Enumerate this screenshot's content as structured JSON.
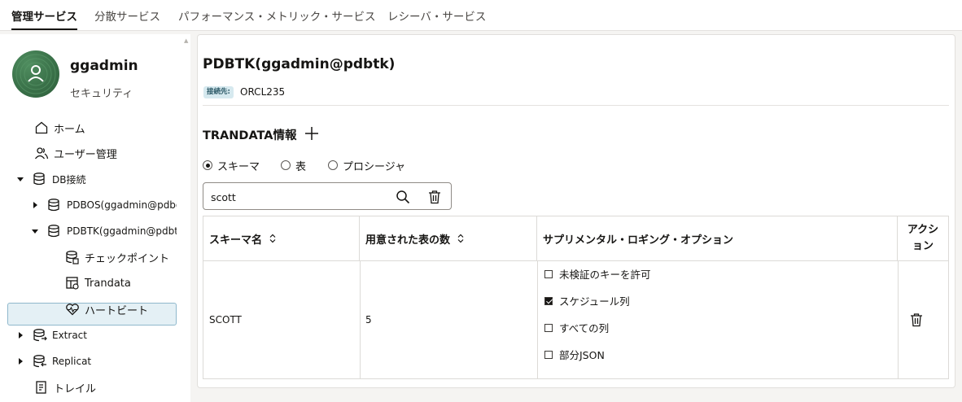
{
  "tabs": [
    {
      "label": "管理サービス"
    },
    {
      "label": "分散サービス"
    },
    {
      "label": "パフォーマンス・メトリック・サービス"
    },
    {
      "label": "レシーバ・サービス"
    }
  ],
  "user": {
    "name": "ggadmin",
    "role": "セキュリティ"
  },
  "sidebar": {
    "items": [
      {
        "label": "ホーム",
        "icon": "home-icon"
      },
      {
        "label": "ユーザー管理",
        "icon": "users-icon"
      },
      {
        "label": "DB接続",
        "icon": "database-icon"
      },
      {
        "label": "PDBOS(ggadmin@pdbos)",
        "icon": "database-icon"
      },
      {
        "label": "PDBTK(ggadmin@pdbtk)",
        "icon": "database-icon"
      },
      {
        "label": "チェックポイント",
        "icon": "checkpoint-icon"
      },
      {
        "label": "Trandata",
        "icon": "trandata-icon"
      },
      {
        "label": "ハートビート",
        "icon": "heartbeat-icon"
      },
      {
        "label": "Extract",
        "icon": "extract-icon"
      },
      {
        "label": "Replicat",
        "icon": "replicat-icon"
      },
      {
        "label": "トレイル",
        "icon": "trail-icon"
      }
    ]
  },
  "main": {
    "title": "PDBTK(ggadmin@pdbtk)",
    "connection_badge": "接続先:",
    "connection_value": "ORCL235",
    "section_title": "TRANDATA情報",
    "radios": [
      {
        "label": "スキーマ",
        "selected": true
      },
      {
        "label": "表",
        "selected": false
      },
      {
        "label": "プロシージャ",
        "selected": false
      }
    ],
    "search": {
      "value": "scott"
    },
    "table": {
      "headers": [
        "スキーマ名",
        "用意された表の数",
        "サプリメンタル・ロギング・オプション",
        "アクション"
      ],
      "action_header_line1": "アクシ",
      "action_header_line2": "ョン",
      "rows": [
        {
          "schema": "SCOTT",
          "count": "5",
          "options": [
            {
              "label": "未検証のキーを許可",
              "checked": false
            },
            {
              "label": "スケジュール列",
              "checked": true
            },
            {
              "label": "すべての列",
              "checked": false
            },
            {
              "label": "部分JSON",
              "checked": false
            }
          ]
        }
      ]
    }
  },
  "colors": {
    "accent": "#161513",
    "selected_bg": "#e4f0f5",
    "avatar": "#3a7149"
  }
}
